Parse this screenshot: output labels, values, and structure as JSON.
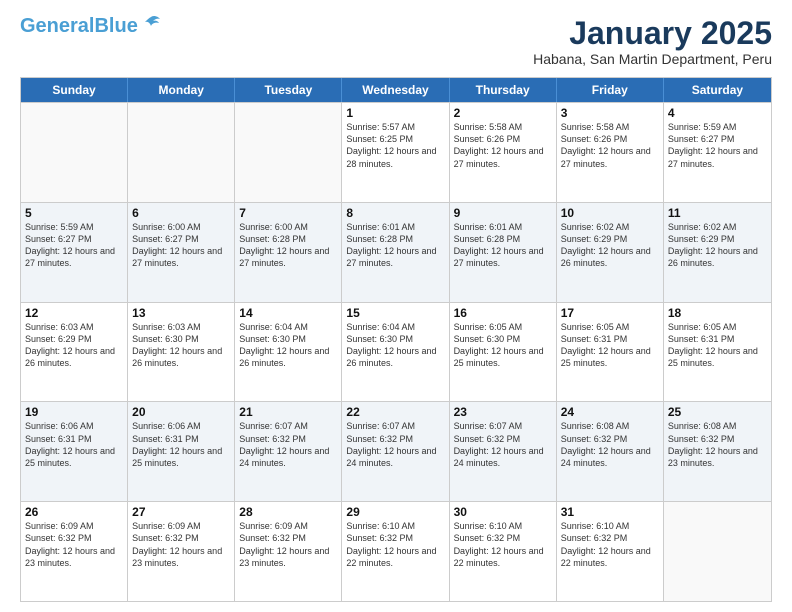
{
  "header": {
    "logo_line1": "General",
    "logo_line2": "Blue",
    "month": "January 2025",
    "location": "Habana, San Martin Department, Peru"
  },
  "days_of_week": [
    "Sunday",
    "Monday",
    "Tuesday",
    "Wednesday",
    "Thursday",
    "Friday",
    "Saturday"
  ],
  "weeks": [
    [
      {
        "day": "",
        "info": ""
      },
      {
        "day": "",
        "info": ""
      },
      {
        "day": "",
        "info": ""
      },
      {
        "day": "1",
        "info": "Sunrise: 5:57 AM\nSunset: 6:25 PM\nDaylight: 12 hours and 28 minutes."
      },
      {
        "day": "2",
        "info": "Sunrise: 5:58 AM\nSunset: 6:26 PM\nDaylight: 12 hours and 27 minutes."
      },
      {
        "day": "3",
        "info": "Sunrise: 5:58 AM\nSunset: 6:26 PM\nDaylight: 12 hours and 27 minutes."
      },
      {
        "day": "4",
        "info": "Sunrise: 5:59 AM\nSunset: 6:27 PM\nDaylight: 12 hours and 27 minutes."
      }
    ],
    [
      {
        "day": "5",
        "info": "Sunrise: 5:59 AM\nSunset: 6:27 PM\nDaylight: 12 hours and 27 minutes."
      },
      {
        "day": "6",
        "info": "Sunrise: 6:00 AM\nSunset: 6:27 PM\nDaylight: 12 hours and 27 minutes."
      },
      {
        "day": "7",
        "info": "Sunrise: 6:00 AM\nSunset: 6:28 PM\nDaylight: 12 hours and 27 minutes."
      },
      {
        "day": "8",
        "info": "Sunrise: 6:01 AM\nSunset: 6:28 PM\nDaylight: 12 hours and 27 minutes."
      },
      {
        "day": "9",
        "info": "Sunrise: 6:01 AM\nSunset: 6:28 PM\nDaylight: 12 hours and 27 minutes."
      },
      {
        "day": "10",
        "info": "Sunrise: 6:02 AM\nSunset: 6:29 PM\nDaylight: 12 hours and 26 minutes."
      },
      {
        "day": "11",
        "info": "Sunrise: 6:02 AM\nSunset: 6:29 PM\nDaylight: 12 hours and 26 minutes."
      }
    ],
    [
      {
        "day": "12",
        "info": "Sunrise: 6:03 AM\nSunset: 6:29 PM\nDaylight: 12 hours and 26 minutes."
      },
      {
        "day": "13",
        "info": "Sunrise: 6:03 AM\nSunset: 6:30 PM\nDaylight: 12 hours and 26 minutes."
      },
      {
        "day": "14",
        "info": "Sunrise: 6:04 AM\nSunset: 6:30 PM\nDaylight: 12 hours and 26 minutes."
      },
      {
        "day": "15",
        "info": "Sunrise: 6:04 AM\nSunset: 6:30 PM\nDaylight: 12 hours and 26 minutes."
      },
      {
        "day": "16",
        "info": "Sunrise: 6:05 AM\nSunset: 6:30 PM\nDaylight: 12 hours and 25 minutes."
      },
      {
        "day": "17",
        "info": "Sunrise: 6:05 AM\nSunset: 6:31 PM\nDaylight: 12 hours and 25 minutes."
      },
      {
        "day": "18",
        "info": "Sunrise: 6:05 AM\nSunset: 6:31 PM\nDaylight: 12 hours and 25 minutes."
      }
    ],
    [
      {
        "day": "19",
        "info": "Sunrise: 6:06 AM\nSunset: 6:31 PM\nDaylight: 12 hours and 25 minutes."
      },
      {
        "day": "20",
        "info": "Sunrise: 6:06 AM\nSunset: 6:31 PM\nDaylight: 12 hours and 25 minutes."
      },
      {
        "day": "21",
        "info": "Sunrise: 6:07 AM\nSunset: 6:32 PM\nDaylight: 12 hours and 24 minutes."
      },
      {
        "day": "22",
        "info": "Sunrise: 6:07 AM\nSunset: 6:32 PM\nDaylight: 12 hours and 24 minutes."
      },
      {
        "day": "23",
        "info": "Sunrise: 6:07 AM\nSunset: 6:32 PM\nDaylight: 12 hours and 24 minutes."
      },
      {
        "day": "24",
        "info": "Sunrise: 6:08 AM\nSunset: 6:32 PM\nDaylight: 12 hours and 24 minutes."
      },
      {
        "day": "25",
        "info": "Sunrise: 6:08 AM\nSunset: 6:32 PM\nDaylight: 12 hours and 23 minutes."
      }
    ],
    [
      {
        "day": "26",
        "info": "Sunrise: 6:09 AM\nSunset: 6:32 PM\nDaylight: 12 hours and 23 minutes."
      },
      {
        "day": "27",
        "info": "Sunrise: 6:09 AM\nSunset: 6:32 PM\nDaylight: 12 hours and 23 minutes."
      },
      {
        "day": "28",
        "info": "Sunrise: 6:09 AM\nSunset: 6:32 PM\nDaylight: 12 hours and 23 minutes."
      },
      {
        "day": "29",
        "info": "Sunrise: 6:10 AM\nSunset: 6:32 PM\nDaylight: 12 hours and 22 minutes."
      },
      {
        "day": "30",
        "info": "Sunrise: 6:10 AM\nSunset: 6:32 PM\nDaylight: 12 hours and 22 minutes."
      },
      {
        "day": "31",
        "info": "Sunrise: 6:10 AM\nSunset: 6:32 PM\nDaylight: 12 hours and 22 minutes."
      },
      {
        "day": "",
        "info": ""
      }
    ]
  ]
}
